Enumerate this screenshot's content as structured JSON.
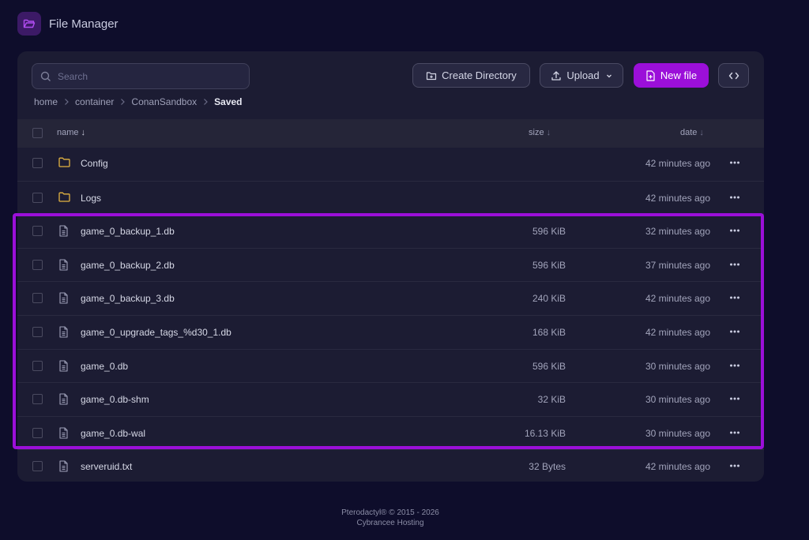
{
  "app": {
    "title": "File Manager"
  },
  "search": {
    "placeholder": "Search"
  },
  "toolbar": {
    "create_directory": "Create Directory",
    "upload": "Upload",
    "new_file": "New file"
  },
  "breadcrumb": [
    "home",
    "container",
    "ConanSandbox",
    "Saved"
  ],
  "table": {
    "headers": {
      "name": "name",
      "size": "size",
      "date": "date"
    },
    "rows": [
      {
        "name": "Config",
        "type": "folder",
        "size": "",
        "date": "42 minutes ago"
      },
      {
        "name": "Logs",
        "type": "folder",
        "size": "",
        "date": "42 minutes ago"
      },
      {
        "name": "game_0_backup_1.db",
        "type": "file",
        "size": "596 KiB",
        "date": "32 minutes ago"
      },
      {
        "name": "game_0_backup_2.db",
        "type": "file",
        "size": "596 KiB",
        "date": "37 minutes ago"
      },
      {
        "name": "game_0_backup_3.db",
        "type": "file",
        "size": "240 KiB",
        "date": "42 minutes ago"
      },
      {
        "name": "game_0_upgrade_tags_%d30_1.db",
        "type": "file",
        "size": "168 KiB",
        "date": "42 minutes ago"
      },
      {
        "name": "game_0.db",
        "type": "file",
        "size": "596 KiB",
        "date": "30 minutes ago"
      },
      {
        "name": "game_0.db-shm",
        "type": "file",
        "size": "32 KiB",
        "date": "30 minutes ago"
      },
      {
        "name": "game_0.db-wal",
        "type": "file",
        "size": "16.13 KiB",
        "date": "30 minutes ago"
      },
      {
        "name": "serveruid.txt",
        "type": "file",
        "size": "32 Bytes",
        "date": "42 minutes ago"
      }
    ]
  },
  "footer": {
    "line1": "Pterodactyl® © 2015 - 2026",
    "line2": "Cybrancee Hosting"
  },
  "colors": {
    "accent": "#9b0fd9",
    "background": "#0e0d2b",
    "panel": "#1c1c33",
    "folder": "#e3b341"
  }
}
